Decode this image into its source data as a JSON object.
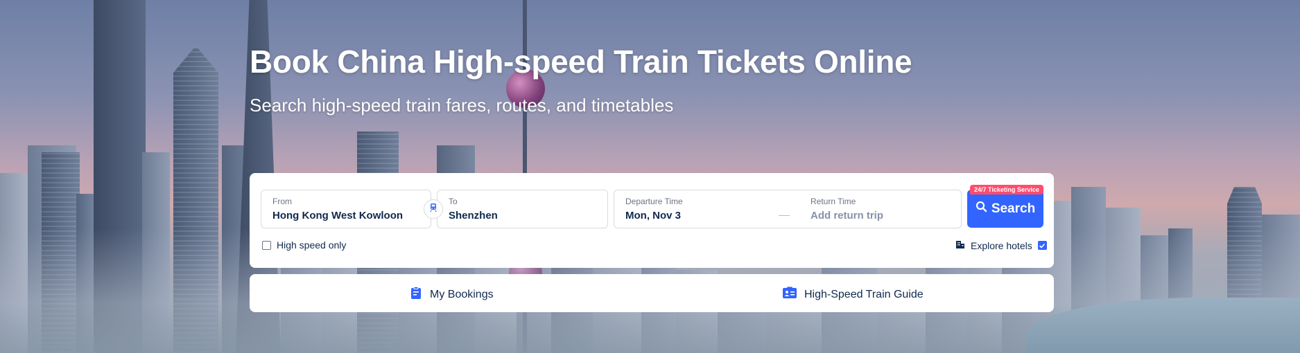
{
  "hero": {
    "title": "Book China High-speed Train Tickets Online",
    "subtitle": "Search high-speed train fares, routes, and timetables"
  },
  "search": {
    "from_label": "From",
    "from_value": "Hong Kong West Kowloon",
    "to_label": "To",
    "to_value": "Shenzhen",
    "departure_label": "Departure Time",
    "departure_value": "Mon, Nov 3",
    "return_label": "Return Time",
    "return_placeholder": "Add return trip",
    "search_button_label": "Search",
    "badge_text": "24/7 Ticketing Service",
    "high_speed_only_label": "High speed only",
    "high_speed_only_checked": false,
    "explore_hotels_label": "Explore hotels",
    "explore_hotels_checked": true
  },
  "links": {
    "my_bookings": "My Bookings",
    "train_guide": "High-Speed Train Guide"
  },
  "icons": {
    "swap": "train-swap-icon",
    "search": "search-icon",
    "hotel": "hotel-icon",
    "bookings": "clipboard-icon",
    "guide": "id-card-icon"
  },
  "colors": {
    "primary": "#3264ff",
    "badge": "#ff4d6d",
    "text_dark": "#0f294d"
  }
}
